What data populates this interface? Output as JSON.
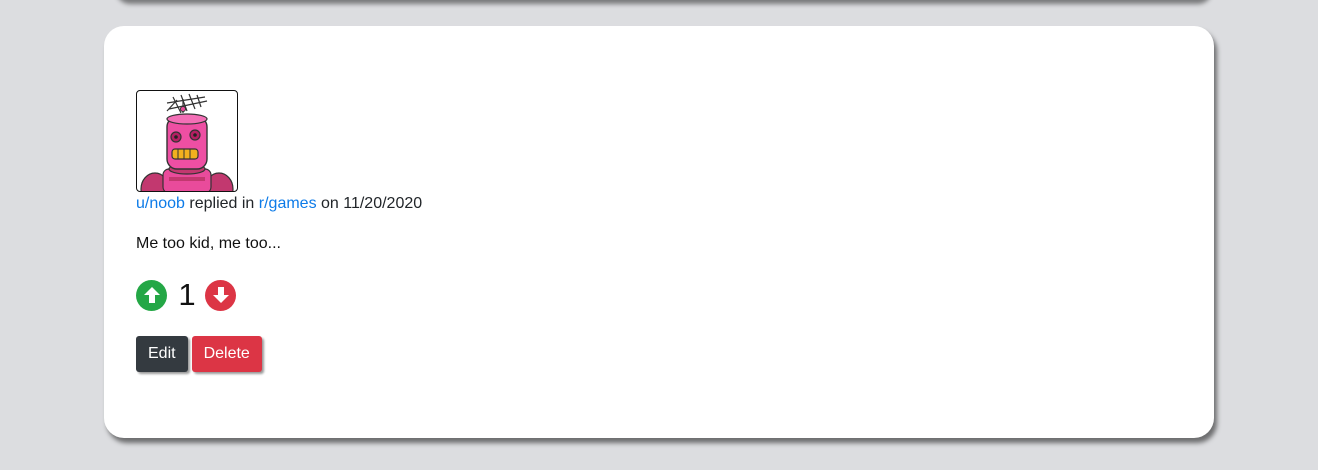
{
  "comment": {
    "author": "u/noob",
    "action_text": " replied in ",
    "subreddit": "r/games",
    "date_text": " on 11/20/2020",
    "body": "Me too kid, me too...",
    "score": "1",
    "avatar_icon": "robot-avatar"
  },
  "actions": {
    "edit_label": "Edit",
    "delete_label": "Delete"
  },
  "colors": {
    "link": "#0d7be8",
    "upvote": "#24a746",
    "downvote": "#dc3545",
    "edit_button": "#343a40",
    "delete_button": "#dc3545",
    "page_background": "#dcdde0"
  },
  "icons": {
    "upvote": "arrow-up-circle-icon",
    "downvote": "arrow-down-circle-icon"
  }
}
